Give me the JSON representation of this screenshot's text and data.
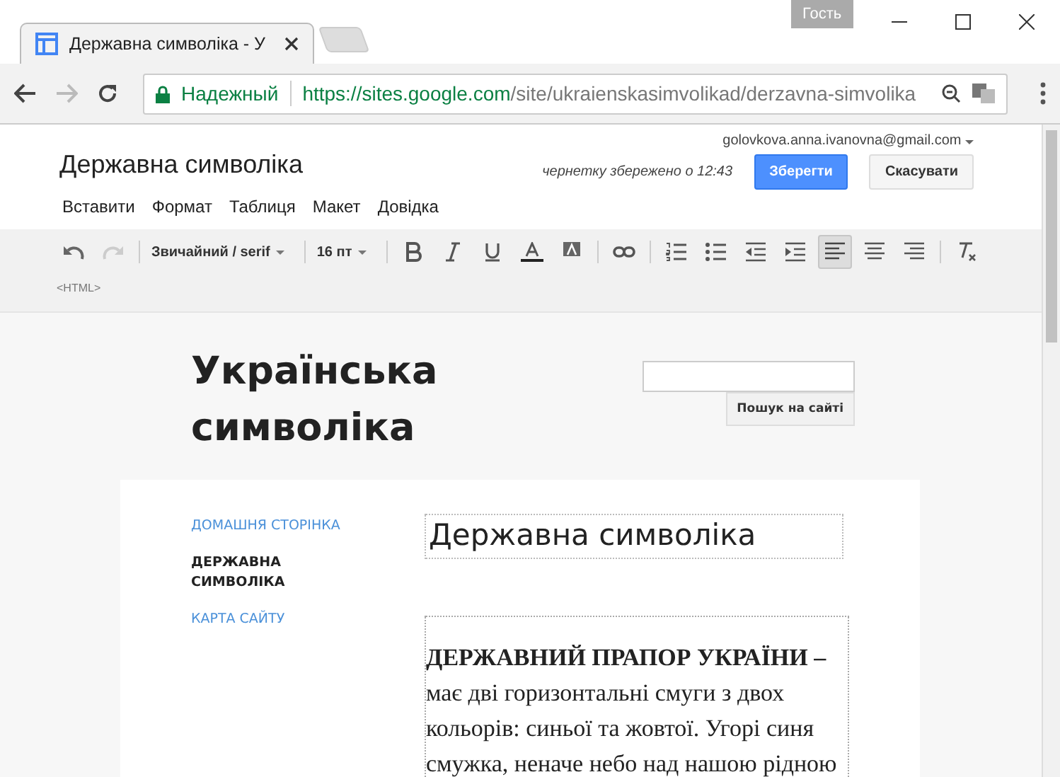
{
  "browser": {
    "profile": "Гость",
    "tab_title": "Державна символіка - У",
    "secure_label": "Надежный",
    "url_host": "https://sites.google.com",
    "url_path": "/site/ukraienskasimvolikad/derzavna-simvolika"
  },
  "editor": {
    "page_title": "Державна символіка",
    "account": "golovkova.anna.ivanovna@gmail.com",
    "draft_status": "чернетку збережено о 12:43",
    "save_button": "Зберегти",
    "cancel_button": "Скасувати",
    "menu": [
      "Вставити",
      "Формат",
      "Таблиця",
      "Макет",
      "Довідка"
    ],
    "toolbar": [
      {
        "kind": "undo",
        "disabled": false
      },
      {
        "kind": "redo",
        "disabled": true
      },
      {
        "kind": "sep"
      },
      {
        "kind": "dropdown",
        "label": "Звичайний / serif"
      },
      {
        "kind": "sep"
      },
      {
        "kind": "dropdown",
        "label": "16 пт"
      },
      {
        "kind": "sep"
      },
      {
        "kind": "bold"
      },
      {
        "kind": "italic"
      },
      {
        "kind": "underline"
      },
      {
        "kind": "textcolor"
      },
      {
        "kind": "highlight"
      },
      {
        "kind": "sep"
      },
      {
        "kind": "link"
      },
      {
        "kind": "sep"
      },
      {
        "kind": "numbered"
      },
      {
        "kind": "bulleted"
      },
      {
        "kind": "outdent"
      },
      {
        "kind": "indent"
      },
      {
        "kind": "align-left",
        "selected": true
      },
      {
        "kind": "align-center",
        "selected": false
      },
      {
        "kind": "align-right",
        "selected": false
      },
      {
        "kind": "sep"
      },
      {
        "kind": "clear"
      },
      {
        "kind": "html",
        "label": "<HTML>"
      }
    ]
  },
  "site": {
    "title": "Українська символіка",
    "search_button": "Пошук на сайті",
    "nav": [
      {
        "label": "ДОМАШНЯ СТОРІНКА",
        "selected": false
      },
      {
        "label": "ДЕРЖАВНА СИМВОЛІКА",
        "selected": true
      },
      {
        "label": "КАРТА САЙТУ",
        "selected": false
      }
    ],
    "heading": "Державна символіка",
    "paragraph": "**ДЕРЖАВНИЙ ПРАПОР УКРАЇНИ –** має дві горизонтальні смуги з двох кольорів: синьої та жовтої. Угорі синя смужка, неначе небо над нашою рідною"
  }
}
